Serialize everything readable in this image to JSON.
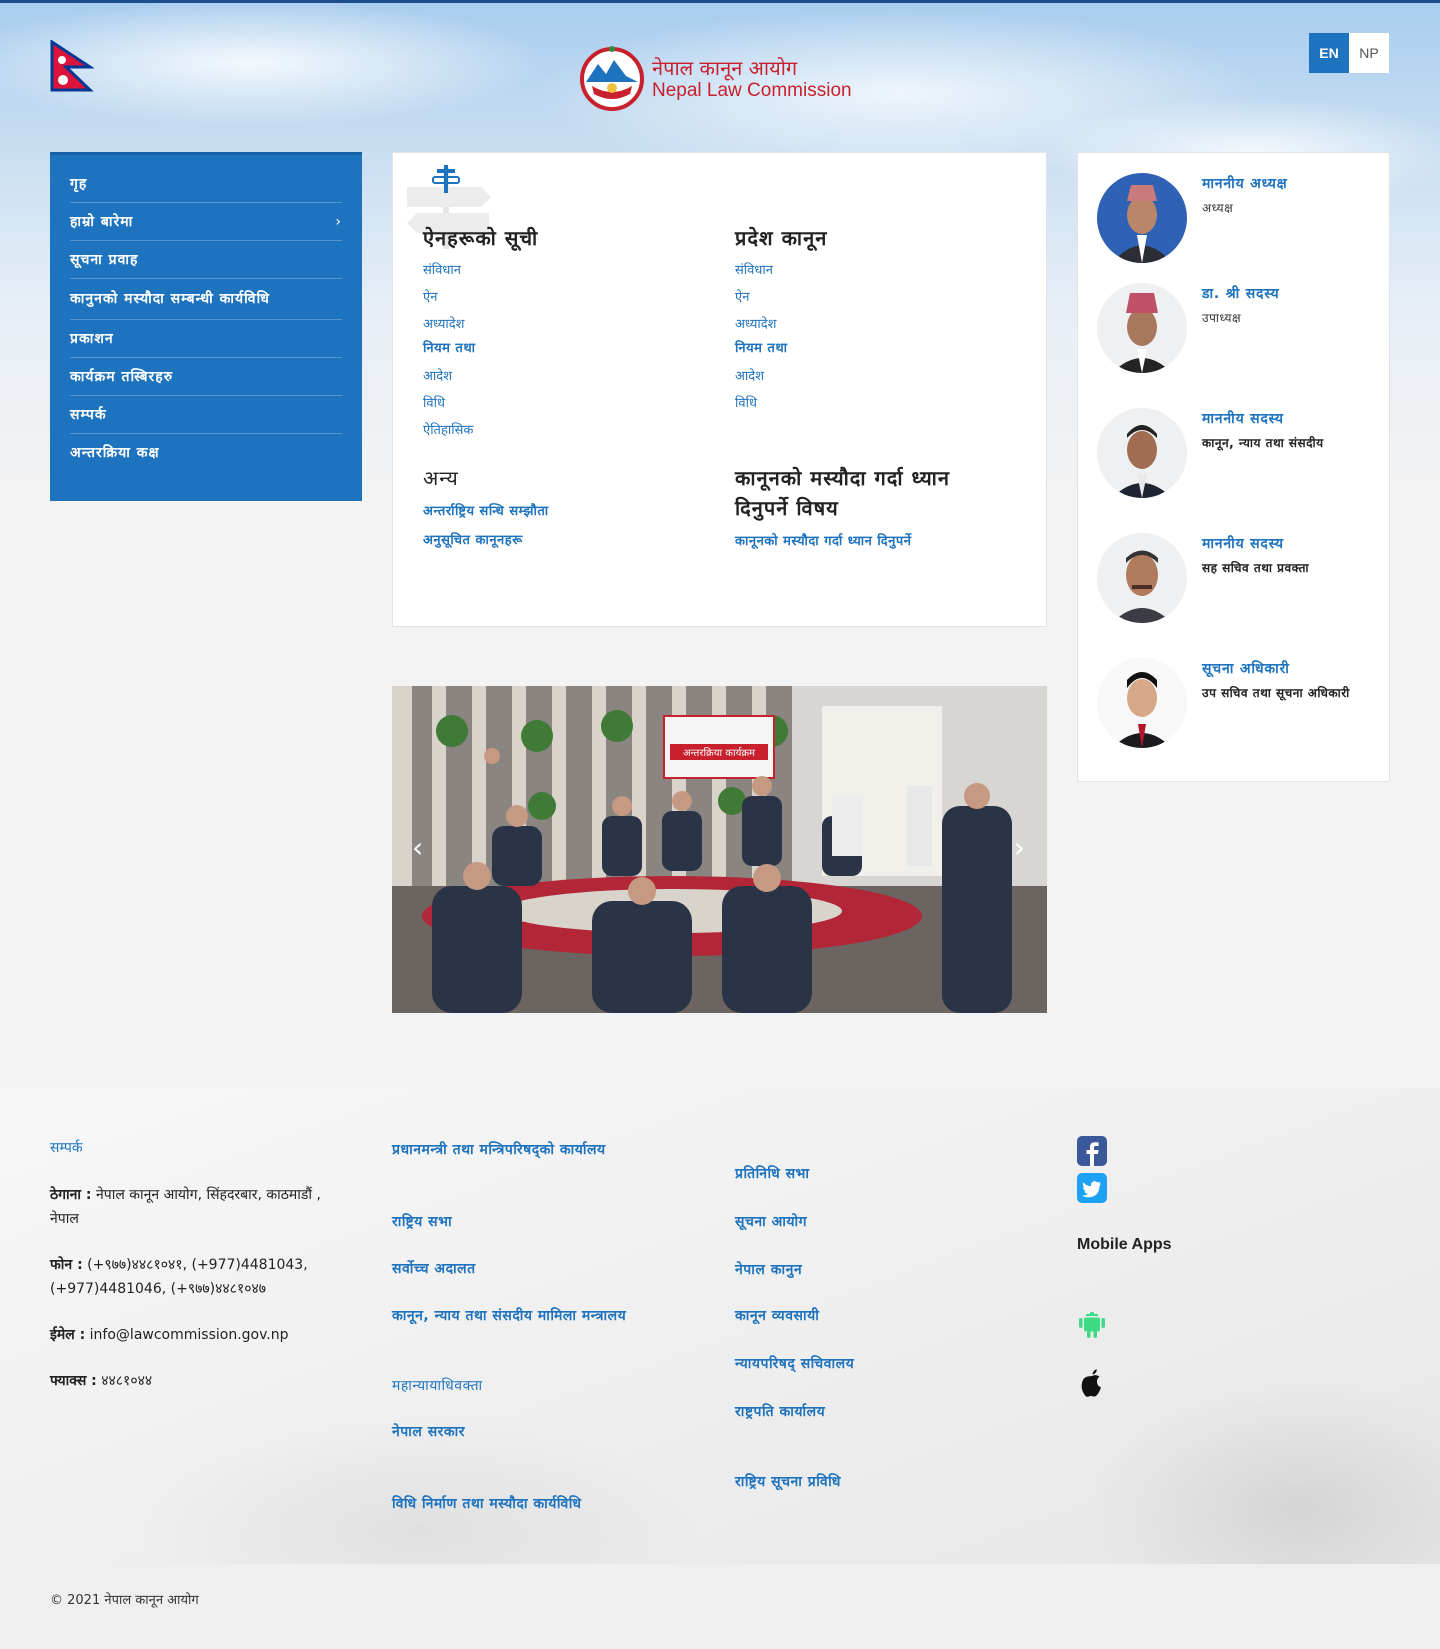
{
  "header": {
    "logo_nepali": "नेपाल कानून आयोग",
    "logo_english": "Nepal Law Commission",
    "lang_en": "EN",
    "lang_np": "NP"
  },
  "sidebar": {
    "items": [
      {
        "label": "गृह",
        "has_submenu": false
      },
      {
        "label": "हाम्रो बारेमा",
        "has_submenu": true
      },
      {
        "label": "सूचना प्रवाह",
        "has_submenu": false
      },
      {
        "label": "कानुनको मस्यौदा सम्बन्धी कार्यविधि",
        "has_submenu": false
      },
      {
        "label": "प्रकाशन",
        "has_submenu": false
      },
      {
        "label": "कार्यक्रम तस्बिरहरु",
        "has_submenu": false
      },
      {
        "label": "सम्पर्क",
        "has_submenu": false
      },
      {
        "label": "अन्तरक्रिया कक्ष",
        "has_submenu": false
      }
    ]
  },
  "links_card": {
    "col1_title": "ऐनहरूको सूची",
    "col1_links": [
      "संविधान",
      "ऐन",
      "अध्यादेश",
      "नियम तथा",
      "आदेश",
      "विधि",
      "ऐतिहासिक"
    ],
    "col2_title": "प्रदेश कानून",
    "col2_links": [
      "संविधान",
      "ऐन",
      "अध्यादेश",
      "नियम तथा",
      "आदेश",
      "विधि"
    ],
    "col3_title": "अन्य",
    "col3_links": [
      "अन्तर्राष्ट्रिय सन्धि सम्झौता",
      "अनुसूचित कानूनहरू"
    ],
    "col4_title": "कानूनको मस्यौदा गर्दा ध्यान दिनुपर्ने विषय",
    "col4_links": [
      "कानूनको मस्यौदा गर्दा ध्यान दिनुपर्ने"
    ]
  },
  "slider": {
    "banner_text": "अन्तरक्रिया कार्यक्रम",
    "prev_icon": "chevron-left-icon",
    "next_icon": "chevron-right-icon"
  },
  "people": [
    {
      "name": "माननीय अध्यक्ष",
      "role": "अध्यक्ष",
      "role_bold": false
    },
    {
      "name": "डा. श्री सदस्य",
      "role": "उपाध्यक्ष",
      "role_bold": false
    },
    {
      "name": "माननीय सदस्य",
      "role": "कानून, न्याय तथा संसदीय",
      "role_bold": true
    },
    {
      "name": "माननीय सदस्य",
      "role": "सह सचिव तथा प्रवक्ता",
      "role_bold": true
    },
    {
      "name": "सूचना अधिकारी",
      "role": "उप सचिव तथा सूचना अधिकारी",
      "role_bold": true
    }
  ],
  "footer": {
    "contact_title": "सम्पर्क",
    "address_label": "ठेगाना :",
    "address_value": "नेपाल कानून आयोग, सिंहदरबार, काठमाडौं , नेपाल",
    "phone_label": "फोन :",
    "phone_value": "(+९७७)४४८१०४१, (+977)4481043, (+977)4481046, (+९७७)४४८१०४७",
    "email_label": "ईमेल :",
    "email_value": "info@lawcommission.gov.np",
    "fax_label": "फ्याक्स :",
    "fax_value": "४४८१०४४",
    "col2_links": [
      "प्रधानमन्त्री तथा मन्त्रिपरिषद्को कार्यालय",
      "राष्ट्रिय सभा",
      "सर्वोच्च अदालत",
      "कानून, न्याय तथा संसदीय मामिला मन्त्रालय",
      "महान्यायाधिवक्ता",
      "नेपाल सरकार",
      "विधि निर्माण तथा मस्यौदा कार्यविधि"
    ],
    "col3_links": [
      "प्रतिनिधि सभा",
      "सूचना आयोग",
      "नेपाल कानुन",
      "कानून व्यवसायी",
      "न्यायपरिषद् सचिवालय",
      "राष्ट्रपति कार्यालय",
      "राष्ट्रिय सूचना प्रविधि"
    ],
    "social": [
      "facebook-icon",
      "twitter-icon"
    ],
    "mobile_apps_title": "Mobile Apps",
    "apps": [
      "android-icon",
      "apple-icon"
    ]
  },
  "copyright": "© 2021 नेपाल कानून आयोग",
  "colors": {
    "accent": "#1e73be",
    "brand_red": "#c8202c"
  }
}
